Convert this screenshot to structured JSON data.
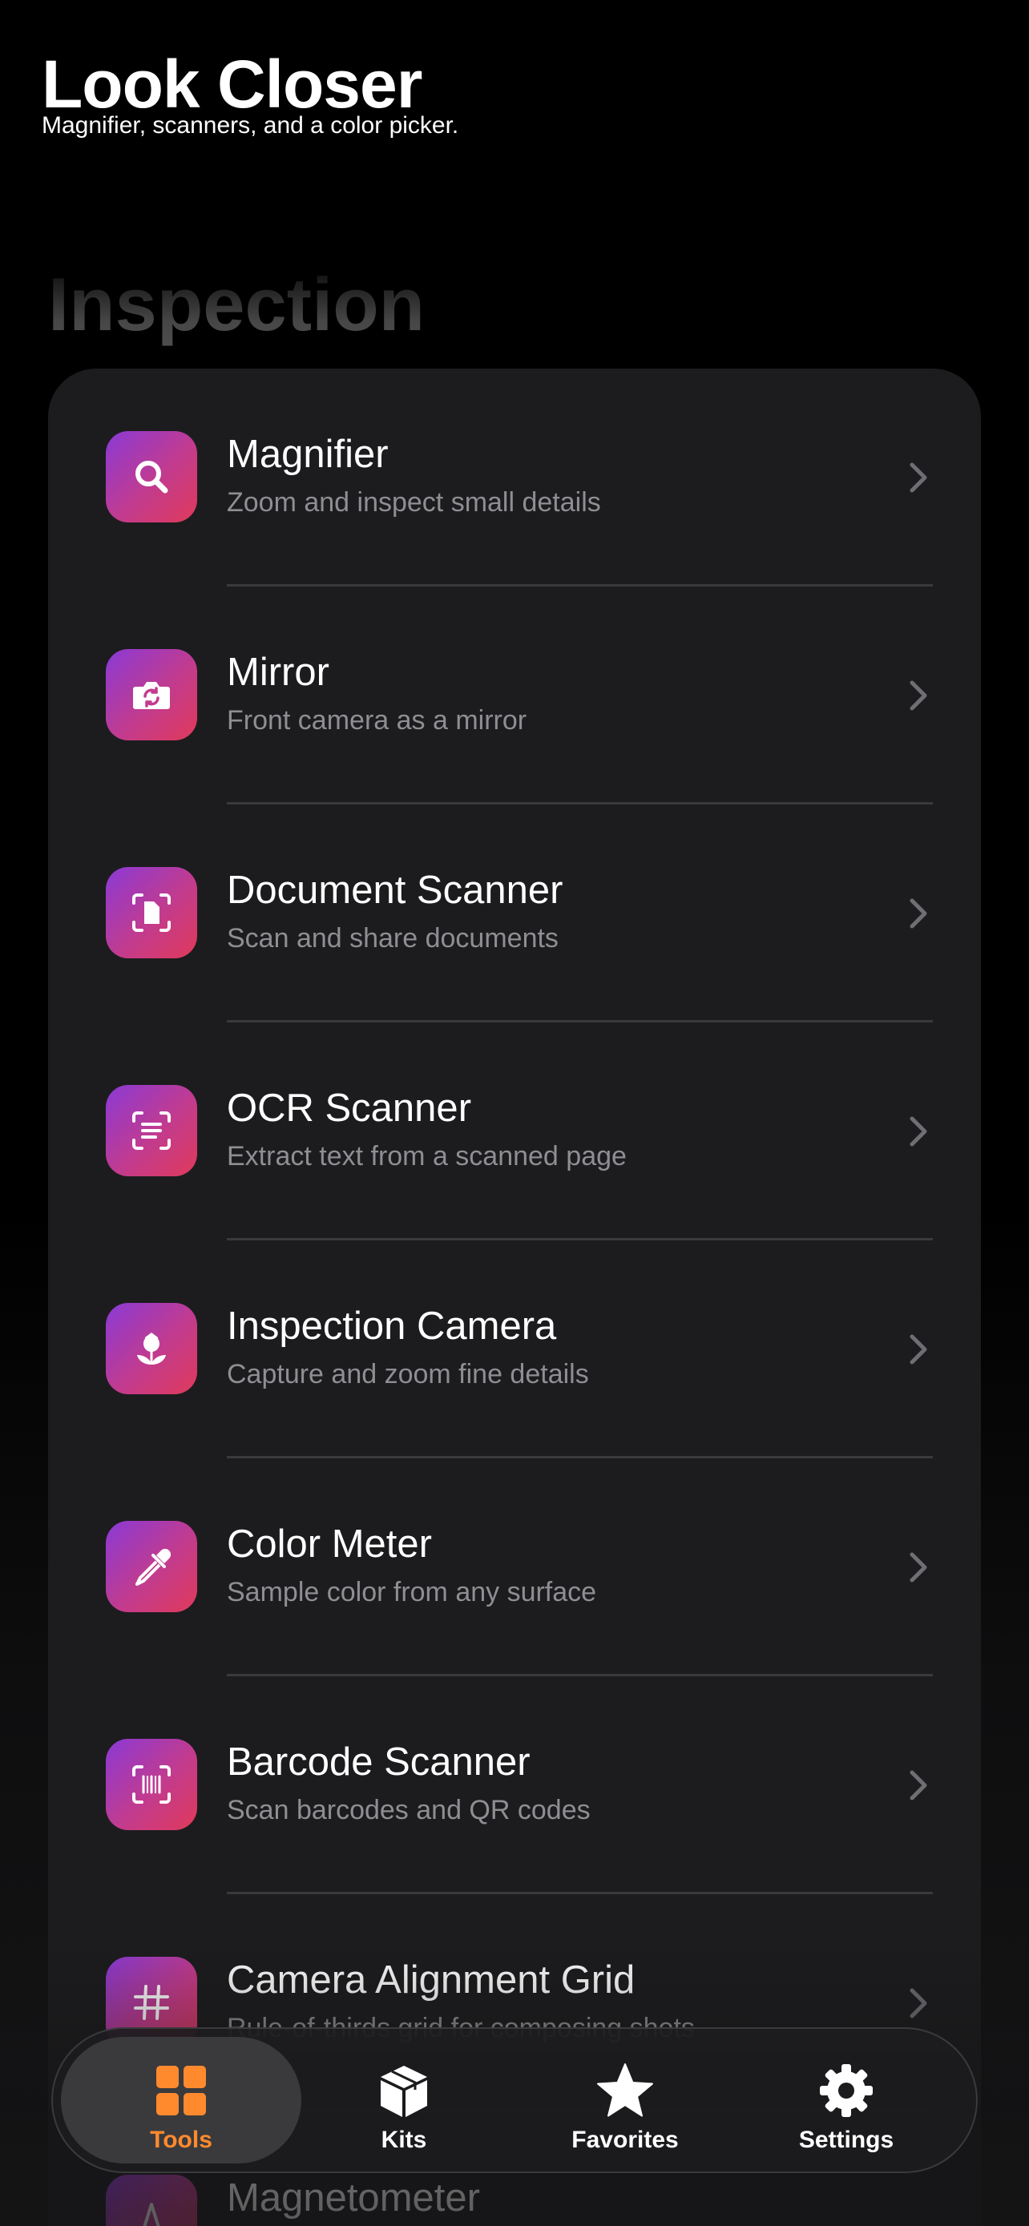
{
  "header": {
    "title": "Look Closer",
    "subtitle": "Magnifier, scanners, and a color picker."
  },
  "section": {
    "title": "Inspection"
  },
  "tools": [
    {
      "title": "Magnifier",
      "subtitle": "Zoom and inspect small details",
      "icon": "magnifying-glass-icon"
    },
    {
      "title": "Mirror",
      "subtitle": "Front camera as a mirror",
      "icon": "camera-rotate-icon"
    },
    {
      "title": "Document Scanner",
      "subtitle": "Scan and share documents",
      "icon": "document-viewfinder-icon"
    },
    {
      "title": "OCR Scanner",
      "subtitle": "Extract text from a scanned page",
      "icon": "text-viewfinder-icon"
    },
    {
      "title": "Inspection Camera",
      "subtitle": "Capture and zoom fine details",
      "icon": "macro-flower-icon"
    },
    {
      "title": "Color Meter",
      "subtitle": "Sample color from any surface",
      "icon": "eyedropper-icon"
    },
    {
      "title": "Barcode Scanner",
      "subtitle": "Scan barcodes and QR codes",
      "icon": "barcode-viewfinder-icon"
    },
    {
      "title": "Camera Alignment Grid",
      "subtitle": "Rule-of-thirds grid for composing shots",
      "icon": "grid-icon"
    },
    {
      "title": "Magnetometer",
      "subtitle": "",
      "icon": "compass-icon"
    }
  ],
  "tab_bar": {
    "tabs": [
      {
        "label": "Tools",
        "icon": "grid-squares-icon",
        "active": true
      },
      {
        "label": "Kits",
        "icon": "box-icon",
        "active": false
      },
      {
        "label": "Favorites",
        "icon": "star-icon",
        "active": false
      },
      {
        "label": "Settings",
        "icon": "gear-icon",
        "active": false
      }
    ]
  },
  "colors": {
    "accent": "#ff8a2e",
    "icon_gradient_start": "#8a3ad6",
    "icon_gradient_end": "#e03a5a",
    "card_background": "#1c1c1e",
    "secondary_text": "#8e8e93"
  }
}
